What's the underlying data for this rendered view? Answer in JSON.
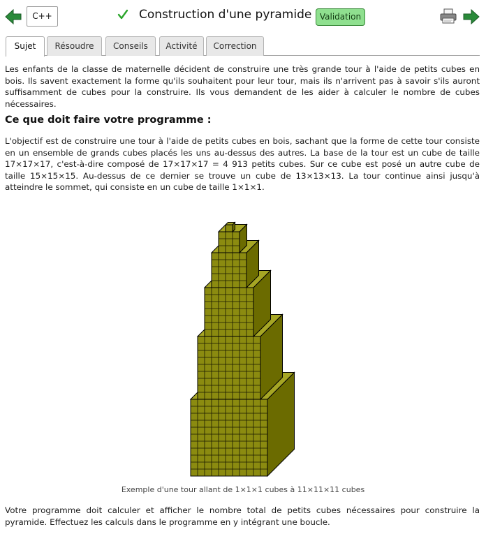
{
  "header": {
    "language": "C++",
    "title": "Construction d'une pyramide",
    "validation_badge": "Validation",
    "nav_prev_icon": "arrow-left-icon",
    "nav_next_icon": "arrow-right-icon",
    "print_icon": "printer-icon",
    "status_icon": "checkmark-icon",
    "colors": {
      "arrow": "#2a8a3a",
      "check": "#2aa52a",
      "badge": "#8fe08f"
    }
  },
  "tabs": [
    {
      "label": "Sujet",
      "active": true
    },
    {
      "label": "Résoudre",
      "active": false
    },
    {
      "label": "Conseils",
      "active": false
    },
    {
      "label": "Activité",
      "active": false
    },
    {
      "label": "Correction",
      "active": false
    }
  ],
  "content": {
    "intro": "Les enfants de la classe de maternelle décident de construire une très grande tour à l'aide de petits cubes en bois. Ils savent exactement la forme qu'ils souhaitent pour leur tour, mais ils n'arrivent pas à savoir s'ils auront suffisamment de cubes pour la construire. Ils vous demandent de les aider à calculer le nombre de cubes nécessaires.",
    "heading": "Ce que doit faire votre programme :",
    "objective": "L'objectif est de construire une tour à l'aide de petits cubes en bois, sachant que la forme de cette tour consiste en un ensemble de grands cubes placés les uns au-dessus des autres. La base de la tour est un cube de taille 17×17×17, c'est-à-dire composé de 17×17×17 = 4 913 petits cubes. Sur ce cube est posé un autre cube de taille 15×15×15. Au-dessus de ce dernier se trouve un cube de 13×13×13. La tour continue ainsi jusqu'à atteindre le sommet, qui consiste en un cube de taille 1×1×1.",
    "figure": {
      "caption": "Exemple d'une tour allant de 1×1×1 cubes à 11×11×11 cubes",
      "cube_sizes": [
        11,
        9,
        7,
        5,
        3,
        1
      ],
      "colors": {
        "front": "#8b8b10",
        "top": "#a6a624",
        "side": "#6b6b00",
        "grid": "#1a1a00"
      }
    },
    "final": "Votre programme doit calculer et afficher le nombre total de petits cubes nécessaires pour construire la pyramide. Effectuez les calculs dans le programme en y intégrant une boucle."
  }
}
